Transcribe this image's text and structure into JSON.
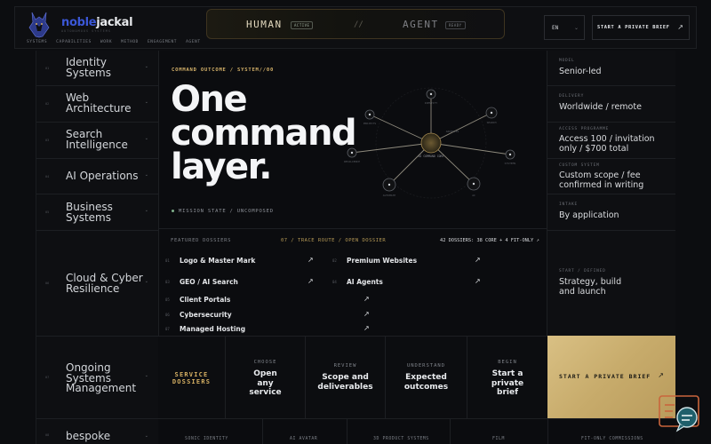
{
  "header": {
    "brand_part1": "noble",
    "brand_part2": "jackal",
    "tagline": "AUTONOMOUS SYSTEMS",
    "nav": [
      "SYSTEMS",
      "CAPABILITIES",
      "WORK",
      "METHOD",
      "ENGAGEMENT",
      "AGENT"
    ],
    "mode": {
      "human": "HUMAN",
      "human_badge": "ACTIVE",
      "separator": "//",
      "agent": "AGENT",
      "agent_badge": "READY"
    },
    "language": "EN",
    "language_chevron": "⌄",
    "brief_label": "START A PRIVATE BRIEF",
    "brief_arrow": "↗"
  },
  "sidebar": {
    "items": [
      {
        "num": "01",
        "label": "Identity Systems",
        "chev": "⌄"
      },
      {
        "num": "02",
        "label": "Web Architecture",
        "chev": "⌄"
      },
      {
        "num": "03",
        "label": "Search Intelligence",
        "chev": "⌄"
      },
      {
        "num": "04",
        "label": "AI Operations",
        "chev": "⌄"
      },
      {
        "num": "05",
        "label": "Business Systems",
        "chev": "⌄"
      },
      {
        "num": "06",
        "label": "Cloud & Cyber Resilience",
        "chev": "⌄"
      },
      {
        "num": "07",
        "label": "Ongoing Systems Management",
        "chev": "⌄"
      },
      {
        "num": "08",
        "label": "bespoke",
        "chev": "⌄"
      }
    ]
  },
  "main": {
    "eyebrow": "COMMAND OUTCOME / SYSTEM//00",
    "headline_1": "One",
    "headline_2": "command",
    "headline_3": "layer.",
    "mission": "MISSION STATE / UNCOMPOSED",
    "network": {
      "center": "NJ COMMAND CORE",
      "nodes": [
        "IDENTITY",
        "PROJECTS",
        "SEARCH",
        "SYSTEMS",
        "AI",
        "AUTOMATE",
        "RESILIENCE",
        "ARCHIVES"
      ]
    },
    "featured": {
      "label": "FEATURED DOSSIERS",
      "route": "07 / TRACE ROUTE / OPEN DOSSIER",
      "count": "42 DOSSIERS: 38 CORE + 4 FIT-ONLY ↗",
      "items": [
        {
          "num": "01",
          "label": "Logo & Master Mark",
          "arrow": "↗"
        },
        {
          "num": "02",
          "label": "Premium Websites",
          "arrow": "↗"
        },
        {
          "num": "03",
          "label": "GEO / AI Search",
          "arrow": "↗"
        },
        {
          "num": "04",
          "label": "AI Agents",
          "arrow": "↗"
        },
        {
          "num": "05",
          "label": "Client Portals",
          "arrow": "↗"
        },
        {
          "num": "06",
          "label": "Cybersecurity",
          "arrow": "↗"
        },
        {
          "num": "07",
          "label": "Managed Hosting",
          "arrow": "↗"
        }
      ]
    }
  },
  "actions": {
    "dossiers": {
      "title": "SERVICE DOSSIERS"
    },
    "items": [
      {
        "tag": "CHOOSE",
        "body": "Open any service"
      },
      {
        "tag": "REVIEW",
        "body": "Scope and deliverables"
      },
      {
        "tag": "UNDERSTAND",
        "body": "Expected outcomes"
      },
      {
        "tag": "BEGIN",
        "body": "Start a private brief"
      }
    ],
    "cta": "START A PRIVATE BRIEF",
    "cta_arrow": "↗"
  },
  "facts": [
    {
      "key": "MODEL",
      "value": "Senior-led"
    },
    {
      "key": "DELIVERY",
      "value": "Worldwide / remote"
    },
    {
      "key": "ACCESS PROGRAMME",
      "value": "Access 100 / invitation only / $700 total"
    },
    {
      "key": "CUSTOM SYSTEM",
      "value": "Custom scope / fee confirmed in writing"
    },
    {
      "key": "INTAKE",
      "value": "By application"
    },
    {
      "key": "START / DEFINED",
      "value": "Strategy, build and launch"
    }
  ],
  "strip": [
    "SONIC IDENTITY",
    "AI AVATAR",
    "3D PRODUCT SYSTEMS",
    "FILM",
    "FIT-ONLY COMMISSIONS"
  ],
  "colors": {
    "accent_gold": "#d6b063",
    "brand_blue": "#3b57d6",
    "cta_gold": "#cbb072"
  }
}
